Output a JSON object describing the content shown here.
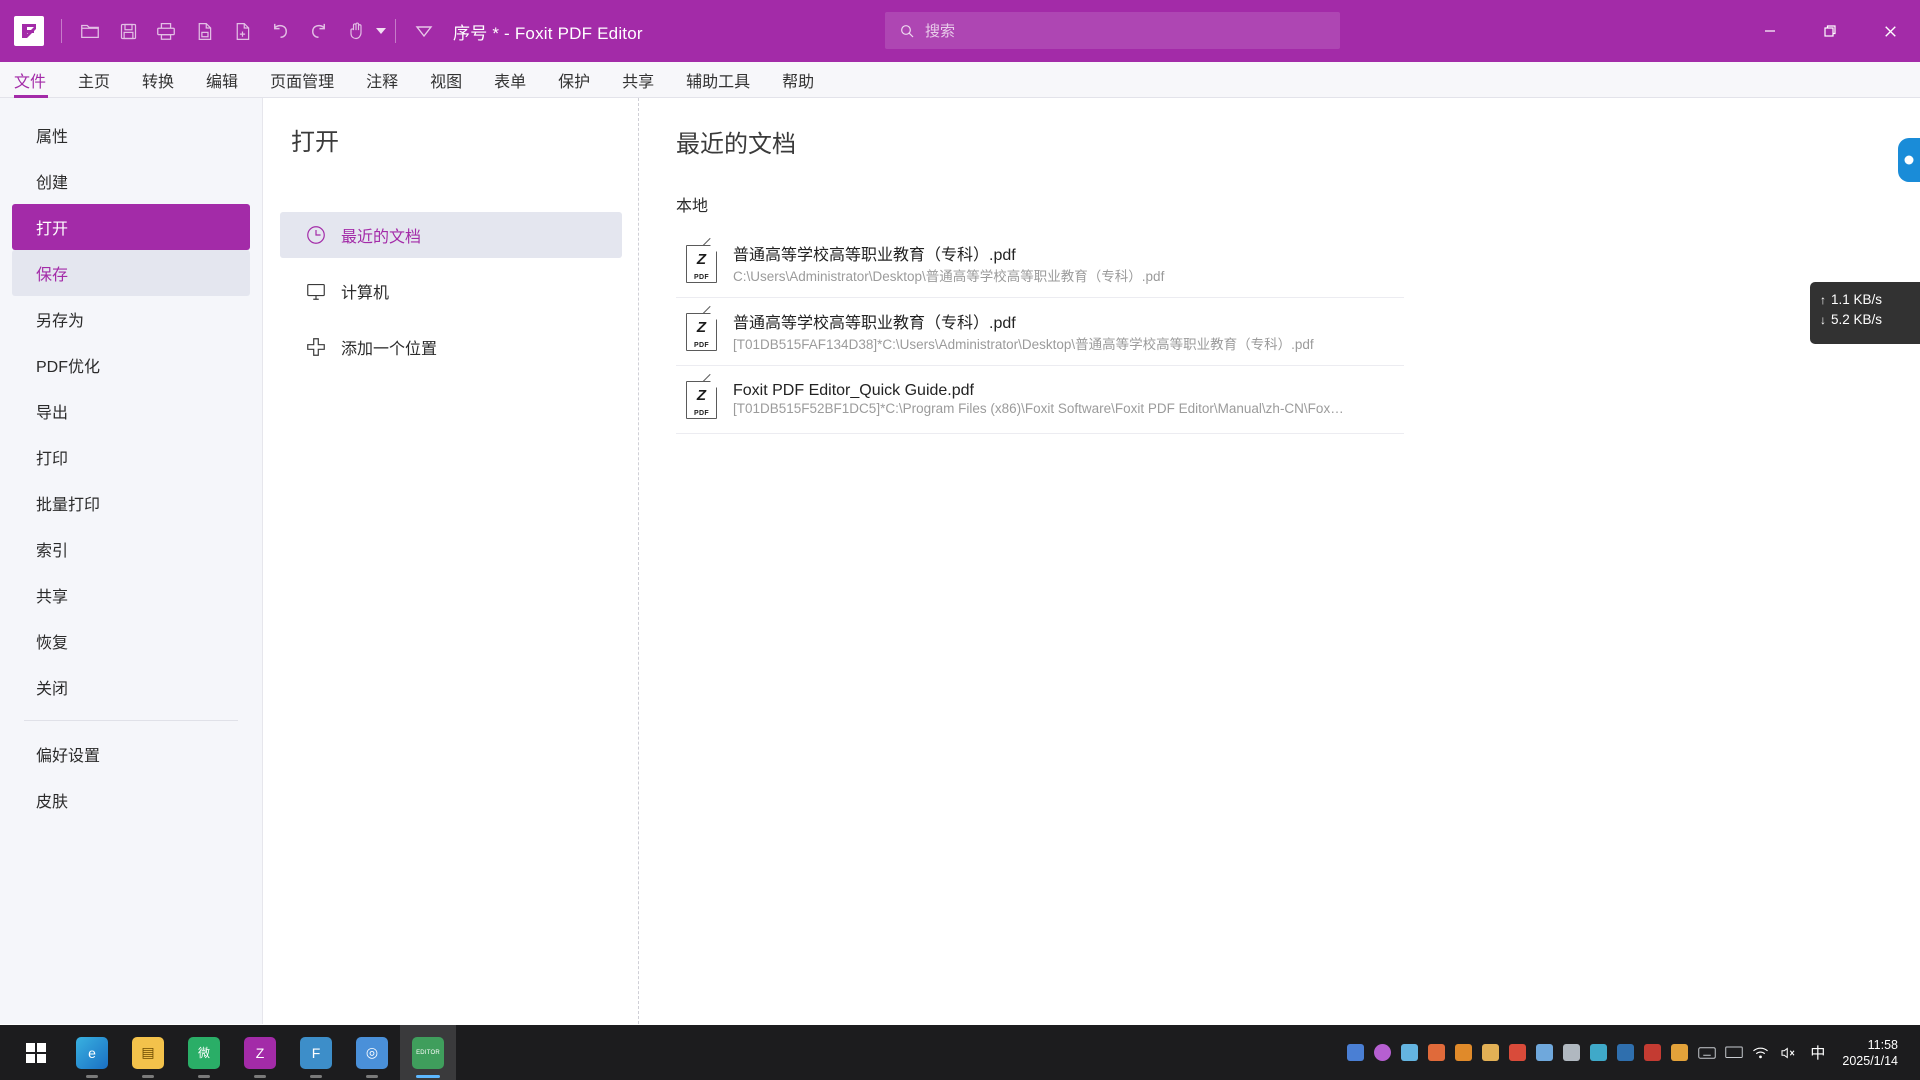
{
  "titlebar": {
    "app_logo": "foxit-logo-icon",
    "document_title": "序号 * - Foxit PDF Editor",
    "search_placeholder": "搜索",
    "quick_tools": [
      {
        "name": "open-icon",
        "label": "打开"
      },
      {
        "name": "save-icon",
        "label": "保存"
      },
      {
        "name": "print-icon",
        "label": "打印"
      },
      {
        "name": "email-icon",
        "label": "发送邮件"
      },
      {
        "name": "new-page-icon",
        "label": "新建"
      },
      {
        "name": "undo-icon",
        "label": "撤销"
      },
      {
        "name": "redo-icon",
        "label": "重做"
      },
      {
        "name": "hand-tool-icon",
        "label": "手形工具"
      },
      {
        "name": "customize-toolbar-icon",
        "label": "自定义工具栏"
      }
    ],
    "window_buttons": [
      {
        "name": "minimize-button",
        "glyph": "—"
      },
      {
        "name": "restore-button",
        "glyph": "❐"
      },
      {
        "name": "close-button",
        "glyph": "✕"
      }
    ]
  },
  "menubar": {
    "active_index": 0,
    "items": [
      {
        "label": "文件"
      },
      {
        "label": "主页"
      },
      {
        "label": "转换"
      },
      {
        "label": "编辑"
      },
      {
        "label": "页面管理"
      },
      {
        "label": "注释"
      },
      {
        "label": "视图"
      },
      {
        "label": "表单"
      },
      {
        "label": "保护"
      },
      {
        "label": "共享"
      },
      {
        "label": "辅助工具"
      },
      {
        "label": "帮助"
      }
    ]
  },
  "sidebar": {
    "items": [
      {
        "label": "属性",
        "state": "normal"
      },
      {
        "label": "创建",
        "state": "normal"
      },
      {
        "label": "打开",
        "state": "selected"
      },
      {
        "label": "保存",
        "state": "hover"
      },
      {
        "label": "另存为",
        "state": "normal"
      },
      {
        "label": "PDF优化",
        "state": "normal"
      },
      {
        "label": "导出",
        "state": "normal"
      },
      {
        "label": "打印",
        "state": "normal"
      },
      {
        "label": "批量打印",
        "state": "normal"
      },
      {
        "label": "索引",
        "state": "normal"
      },
      {
        "label": "共享",
        "state": "normal"
      },
      {
        "label": "恢复",
        "state": "normal"
      },
      {
        "label": "关闭",
        "state": "normal"
      }
    ],
    "bottom_items": [
      {
        "label": "偏好设置"
      },
      {
        "label": "皮肤"
      }
    ]
  },
  "midpanel": {
    "title": "打开",
    "items": [
      {
        "label": "最近的文档",
        "icon": "clock-icon",
        "state": "selected"
      },
      {
        "label": "计算机",
        "icon": "computer-icon",
        "state": "normal"
      },
      {
        "label": "添加一个位置",
        "icon": "plus-icon",
        "state": "normal"
      }
    ]
  },
  "rightpanel": {
    "title": "最近的文档",
    "section_label": "本地",
    "documents": [
      {
        "name": "普通高等学校高等职业教育（专科）.pdf",
        "path": "C:\\Users\\Administrator\\Desktop\\普通高等学校高等职业教育（专科）.pdf",
        "icon": "pdf-file-icon"
      },
      {
        "name": "普通高等学校高等职业教育（专科）.pdf",
        "path": "[T01DB515FAF134D38]*C:\\Users\\Administrator\\Desktop\\普通高等学校高等职业教育（专科）.pdf",
        "icon": "pdf-file-icon"
      },
      {
        "name": "Foxit PDF Editor_Quick Guide.pdf",
        "path": "[T01DB515F52BF1DC5]*C:\\Program Files (x86)\\Foxit Software\\Foxit PDF Editor\\Manual\\zh-CN\\Fox…",
        "icon": "pdf-file-icon"
      }
    ]
  },
  "widgets": {
    "edge_tab": {
      "name": "edge-sidebar-tab",
      "color": "#1a8cd8"
    },
    "netspeed": {
      "upload": "1.1 KB/s",
      "download": "5.2 KB/s",
      "upload_arrow": "↑",
      "download_arrow": "↓",
      "background": "#323232"
    }
  },
  "taskbar": {
    "start": {
      "name": "windows-start-button"
    },
    "pinned": [
      {
        "name": "taskbar-edge",
        "glyph": "e",
        "color": "#1a7fd4",
        "state": "run"
      },
      {
        "name": "taskbar-file-explorer",
        "glyph": "🗂",
        "color": "#f3c24b",
        "state": "run"
      },
      {
        "name": "taskbar-wechat",
        "glyph": "微",
        "color": "#2aae67",
        "state": "run"
      },
      {
        "name": "taskbar-foxit-1",
        "glyph": "Z",
        "color": "#a32ba8",
        "state": "run"
      },
      {
        "name": "taskbar-foxit-reader",
        "glyph": "F",
        "color": "#3d8ec9",
        "state": "run"
      },
      {
        "name": "taskbar-browser",
        "glyph": "◎",
        "color": "#4a90d9",
        "state": "run"
      },
      {
        "name": "taskbar-foxit-editor",
        "glyph": "EDITOR",
        "color": "#3f9e5c",
        "state": "active"
      }
    ],
    "tray": [
      {
        "name": "tray-screen-record-icon",
        "color": "#4a7fd4"
      },
      {
        "name": "tray-notification-icon",
        "color": "#b65fd1"
      },
      {
        "name": "tray-app-icon",
        "color": "#64b4e0"
      },
      {
        "name": "tray-paint-icon",
        "color": "#e06a3a"
      },
      {
        "name": "tray-link-icon",
        "color": "#e08a2a"
      },
      {
        "name": "tray-folder-icon",
        "color": "#e2b055"
      },
      {
        "name": "tray-shield-icon",
        "color": "#d94b3a"
      },
      {
        "name": "tray-grid-icon",
        "color": "#6fa8dc"
      },
      {
        "name": "tray-window-icon",
        "color": "#b0b8c0"
      },
      {
        "name": "tray-chat-icon",
        "color": "#3fa9c9"
      },
      {
        "name": "tray-foxit-tray-icon",
        "color": "#2f6fae"
      },
      {
        "name": "tray-red-icon",
        "color": "#c43b32"
      },
      {
        "name": "tray-alert-icon",
        "color": "#e3a23a"
      },
      {
        "name": "tray-keyboard-icon",
        "color": "#c9ccd1"
      },
      {
        "name": "tray-display-icon",
        "color": "#c9ccd1"
      },
      {
        "name": "tray-wifi-icon",
        "color": "#ffffff"
      },
      {
        "name": "tray-volume-mute-icon",
        "color": "#ffffff"
      }
    ],
    "ime_label": "中",
    "clock_time": "11:58",
    "clock_date": "2025/1/14"
  }
}
